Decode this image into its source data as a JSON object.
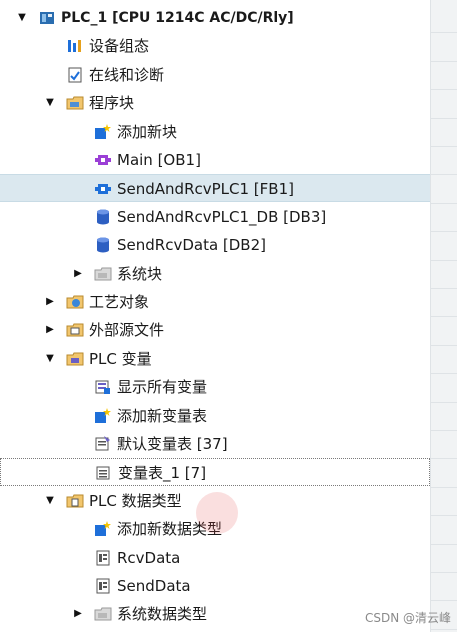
{
  "tree": [
    {
      "label": "PLC_1 [CPU 1214C AC/DC/Rly]",
      "level": 0,
      "toggle": "expanded",
      "icon": "plc-device-icon",
      "root": true
    },
    {
      "label": "设备组态",
      "level": 1,
      "toggle": "none",
      "icon": "device-config-icon"
    },
    {
      "label": "在线和诊断",
      "level": 1,
      "toggle": "none",
      "icon": "online-diagnostics-icon"
    },
    {
      "label": "程序块",
      "level": 1,
      "toggle": "expanded",
      "icon": "folder-icon"
    },
    {
      "label": "添加新块",
      "level": 2,
      "toggle": "none",
      "icon": "add-new-icon"
    },
    {
      "label": "Main [OB1]",
      "level": 2,
      "toggle": "none",
      "icon": "ob-block-icon"
    },
    {
      "label": "SendAndRcvPLC1 [FB1]",
      "level": 2,
      "toggle": "none",
      "icon": "fb-block-icon",
      "state": "highlighted"
    },
    {
      "label": "SendAndRcvPLC1_DB [DB3]",
      "level": 2,
      "toggle": "none",
      "icon": "db-block-icon"
    },
    {
      "label": "SendRcvData [DB2]",
      "level": 2,
      "toggle": "none",
      "icon": "db-block-icon"
    },
    {
      "label": "系统块",
      "level": 2,
      "toggle": "collapsed",
      "icon": "system-folder-icon"
    },
    {
      "label": "工艺对象",
      "level": 1,
      "toggle": "collapsed",
      "icon": "technology-folder-icon"
    },
    {
      "label": "外部源文件",
      "level": 1,
      "toggle": "collapsed",
      "icon": "external-source-folder-icon"
    },
    {
      "label": "PLC 变量",
      "level": 1,
      "toggle": "expanded",
      "icon": "tag-folder-icon"
    },
    {
      "label": "显示所有变量",
      "level": 2,
      "toggle": "none",
      "icon": "show-all-tags-icon"
    },
    {
      "label": "添加新变量表",
      "level": 2,
      "toggle": "none",
      "icon": "add-new-icon"
    },
    {
      "label": "默认变量表 [37]",
      "level": 2,
      "toggle": "none",
      "icon": "default-tag-table-icon"
    },
    {
      "label": "变量表_1 [7]",
      "level": 2,
      "toggle": "none",
      "icon": "tag-table-icon",
      "state": "focused"
    },
    {
      "label": "PLC 数据类型",
      "level": 1,
      "toggle": "expanded",
      "icon": "datatype-folder-icon"
    },
    {
      "label": "添加新数据类型",
      "level": 2,
      "toggle": "none",
      "icon": "add-new-icon"
    },
    {
      "label": "RcvData",
      "level": 2,
      "toggle": "none",
      "icon": "datatype-icon"
    },
    {
      "label": "SendData",
      "level": 2,
      "toggle": "none",
      "icon": "datatype-icon"
    },
    {
      "label": "系统数据类型",
      "level": 2,
      "toggle": "collapsed",
      "icon": "system-folder-icon"
    }
  ],
  "watermark": "CSDN @清云峰",
  "colors": {
    "highlight": "#dbe8ef",
    "accent": "#1e6fd9"
  }
}
